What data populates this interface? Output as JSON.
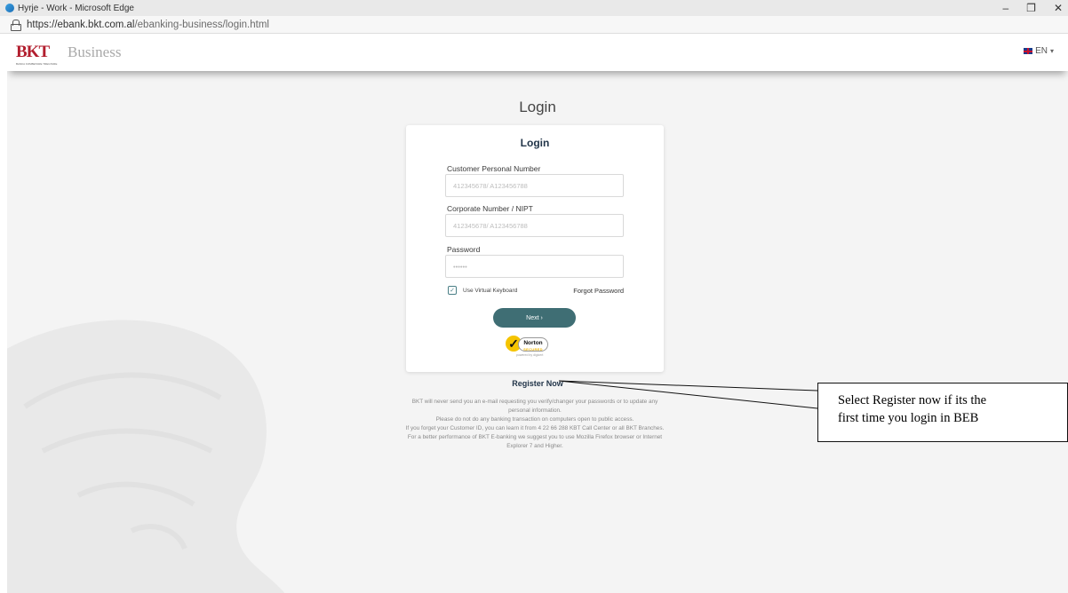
{
  "browser": {
    "window_title": "Hyrje - Work - Microsoft Edge",
    "url_host": "https://ebank.bkt.com.al",
    "url_path": "/ebanking-business/login.html",
    "controls": {
      "minimize": "–",
      "restore": "❐",
      "close": "✕"
    }
  },
  "header": {
    "logo_text": "BKT",
    "logo_subtitle": "BANKA KOMBETARE TREGTARE",
    "brand": "Business",
    "language": "EN"
  },
  "page_title": "Login",
  "login": {
    "title": "Login",
    "customer_label": "Customer Personal Number",
    "customer_placeholder": "412345678/ A123456788",
    "corporate_label": "Corporate Number / NIPT",
    "corporate_placeholder": "412345678/ A123456788",
    "password_label": "Password",
    "password_placeholder": "••••••",
    "virtual_keyboard_label": "Use Virtual Keyboard",
    "virtual_keyboard_checked": true,
    "forgot_password": "Forgot Password",
    "next_button": "Next ›"
  },
  "norton": {
    "name": "Norton",
    "secured": "SECURED",
    "powered_by": "powered by digicert"
  },
  "register_now": "Register Now",
  "notice_lines": [
    "BKT will never send you an e-mail requesting you verify/changer your passwords or to update any personal information.",
    "Please do not do any banking transaction on computers open to public access.",
    "If you forget your Customer ID, you can learn it from 4 22 66 288 KBT Call Center or all BKT Branches.",
    "For a better performance of BKT E-banking we suggest you to use Mozilla Firefox browser or Internet Explorer 7 and Higher."
  ],
  "callout": {
    "line1": "Select Register now if its the",
    "line2": "first time you login in BEB"
  }
}
